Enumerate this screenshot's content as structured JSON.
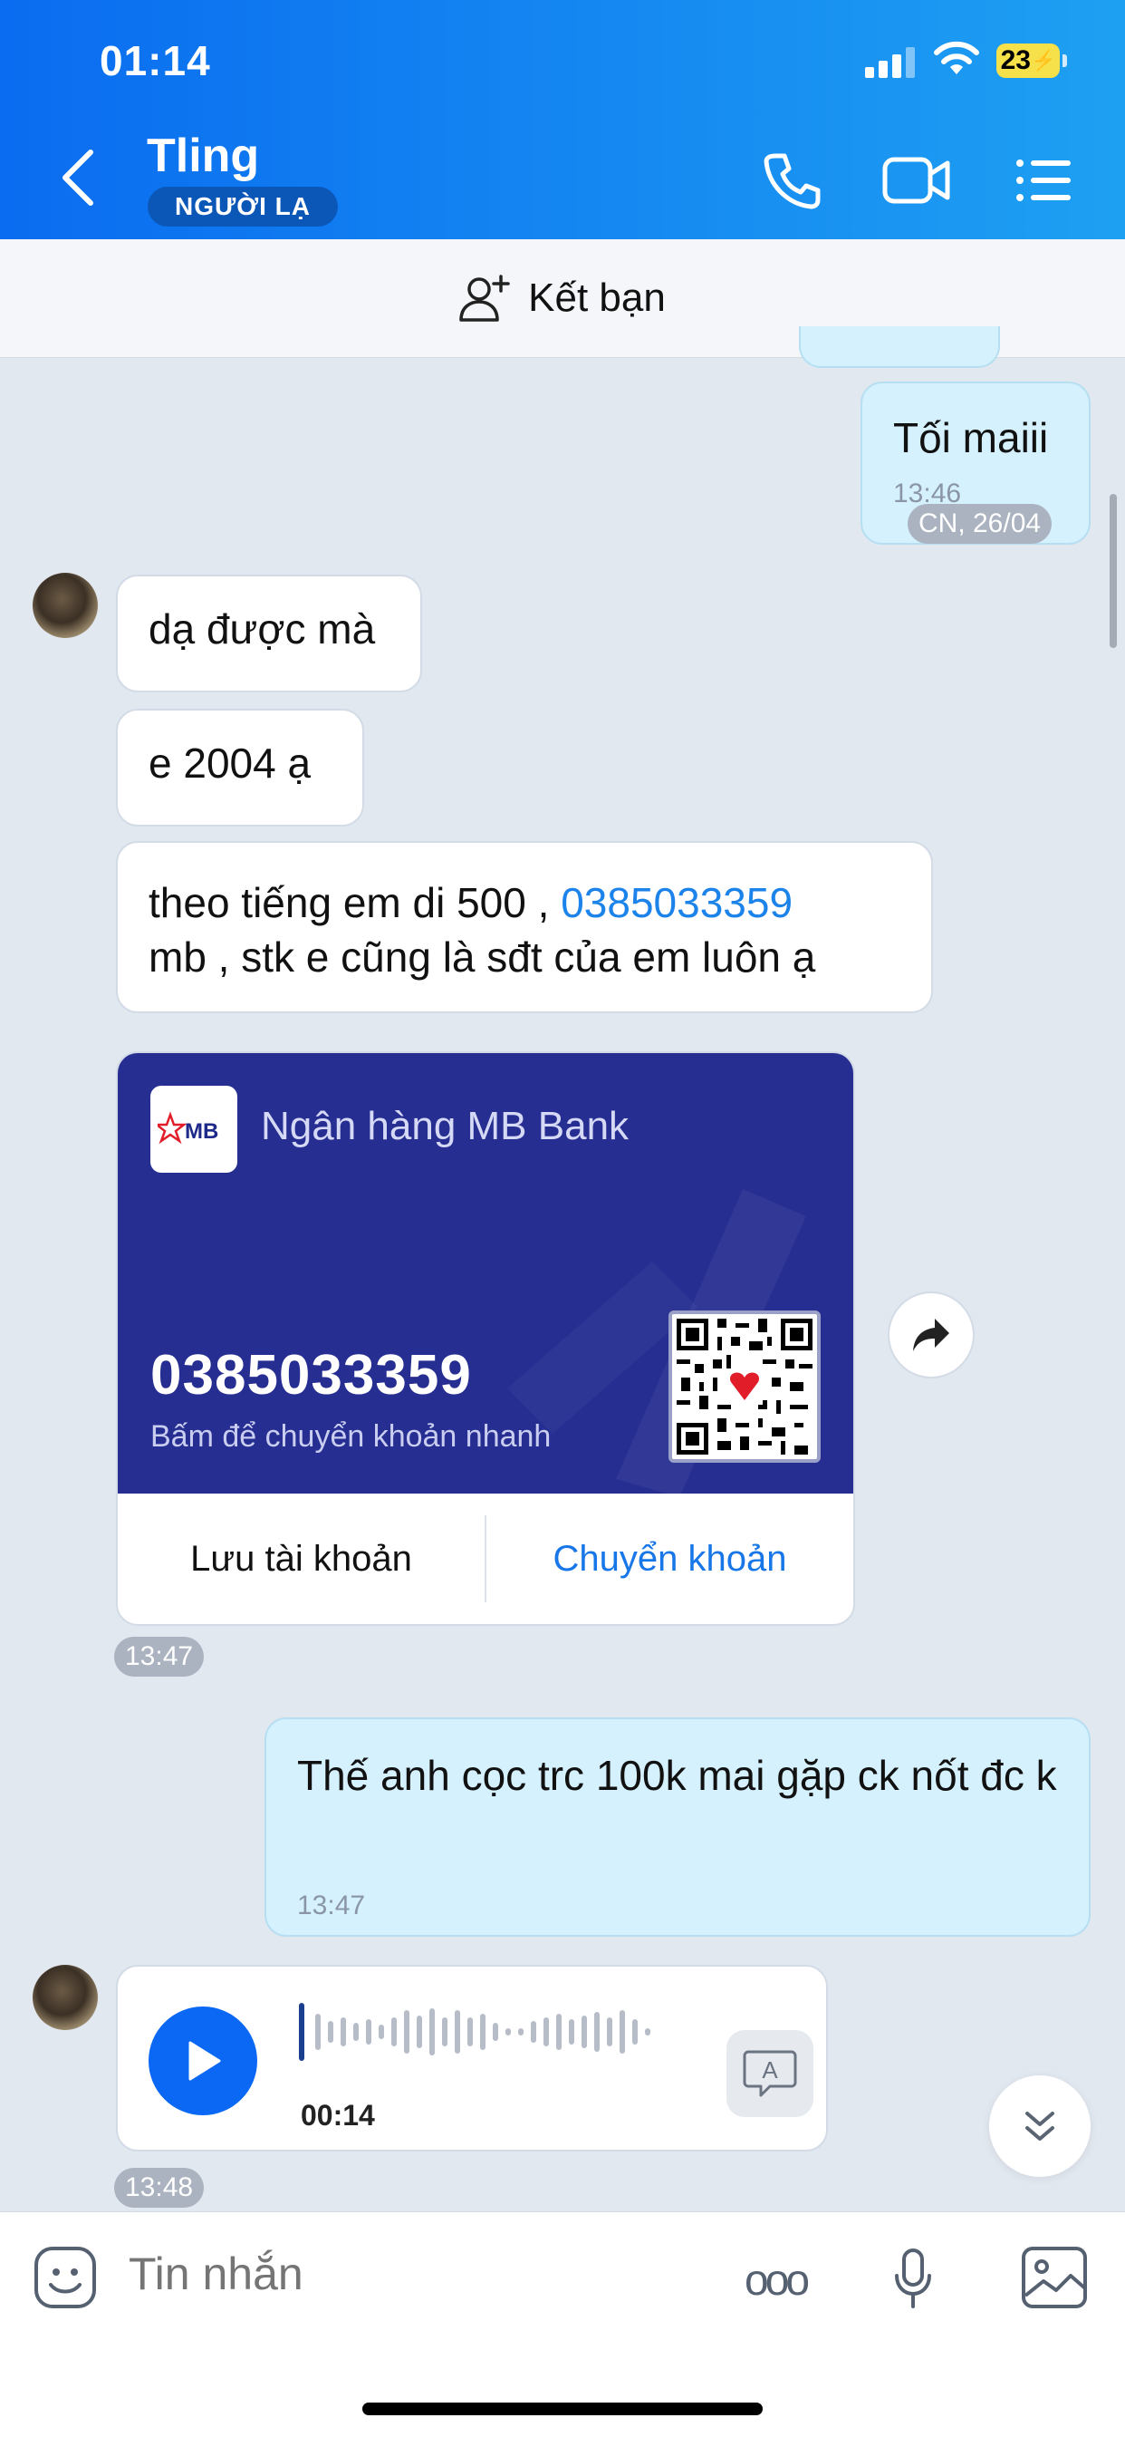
{
  "status_bar": {
    "time": "01:14",
    "battery": "23"
  },
  "header": {
    "name": "Tling",
    "badge": "NGƯỜI LẠ"
  },
  "add_friend": {
    "label": "Kết bạn"
  },
  "messages": {
    "m1": {
      "text": "Tối maiii",
      "time": "13:46",
      "date_pill": "CN, 26/04"
    },
    "m2": {
      "text": "dạ được mà"
    },
    "m3": {
      "text": "e 2004 ạ"
    },
    "m4": {
      "text_before": "theo tiếng em di 500 , ",
      "phone": "0385033359",
      "text_after": "mb  , stk e cũng là sđt của em luôn ạ"
    },
    "card": {
      "bank_name": "Ngân hàng MB Bank",
      "logo_text": "MB",
      "account": "0385033359",
      "hint": "Bấm để chuyển khoản nhanh",
      "save_label": "Lưu tài khoản",
      "transfer_label": "Chuyển khoản",
      "time": "13:47"
    },
    "m5": {
      "text": "Thế anh cọc trc 100k mai gặp ck nốt đc k",
      "time": "13:47"
    },
    "voice": {
      "duration": "00:14",
      "time": "13:48",
      "transcribe_icon_text": "A"
    }
  },
  "composer": {
    "placeholder": "Tin nhắn",
    "more_label": "ooo"
  }
}
